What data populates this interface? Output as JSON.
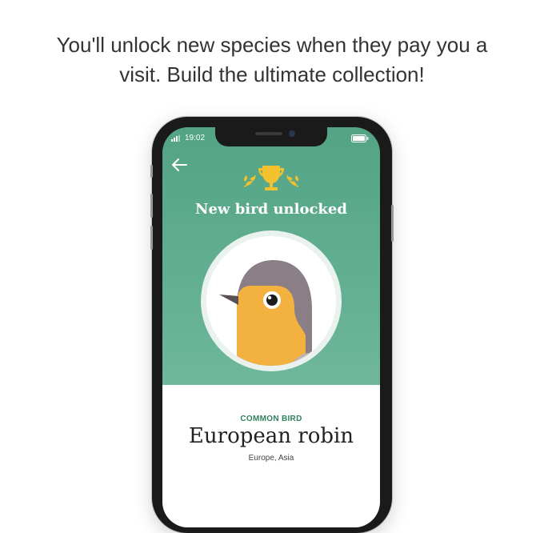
{
  "headline": {
    "line1": "You'll unlock new species when they pay you a",
    "line2": "visit. Build the ultimate collection!"
  },
  "status_bar": {
    "time": "19:02"
  },
  "screen": {
    "title": "New bird unlocked",
    "bird": {
      "category": "COMMON BIRD",
      "name": "European robin",
      "region": "Europe, Asia"
    }
  },
  "icons": [
    "back-arrow-icon",
    "trophy-icon",
    "signal-icon",
    "battery-icon",
    "robin-illustration"
  ],
  "colors": {
    "screen_green": "#5aa88a",
    "category_green": "#2f7f5e",
    "trophy_gold": "#f2c12e",
    "robin_orange": "#f3b240",
    "robin_grey": "#8a7f86"
  }
}
